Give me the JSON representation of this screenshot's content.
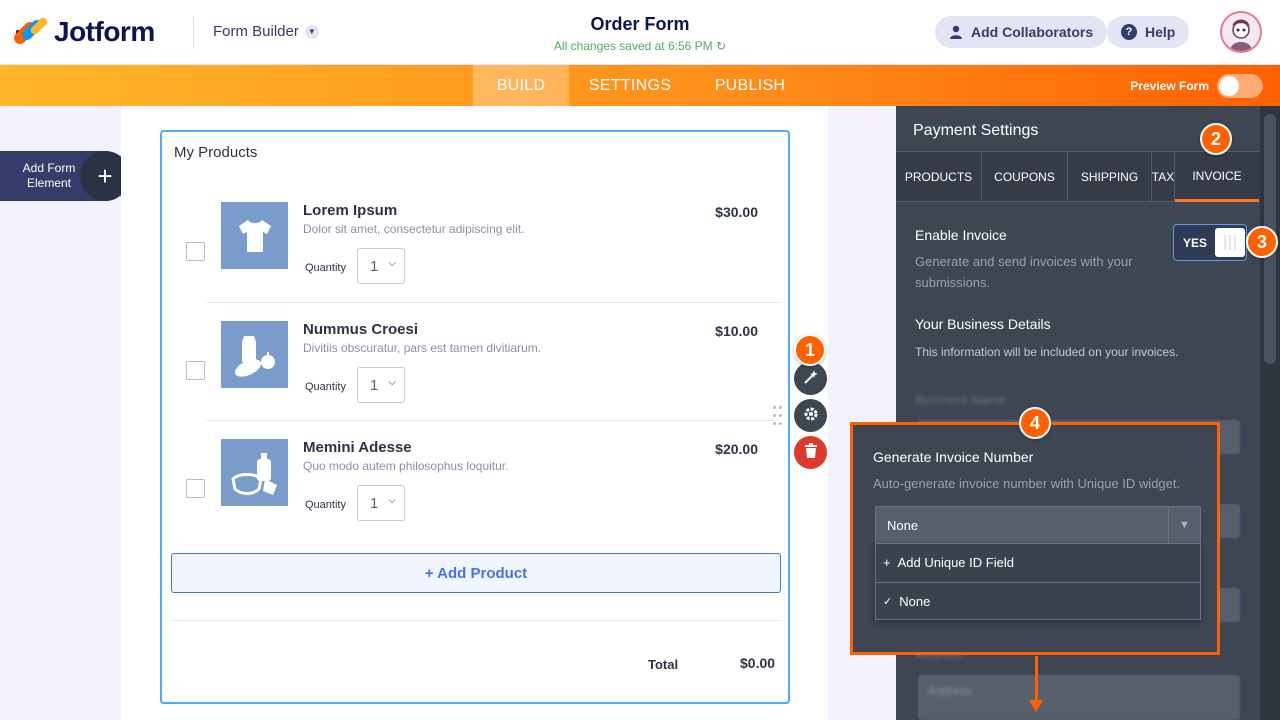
{
  "header": {
    "logo_text": "Jotform",
    "builder_label": "Form Builder",
    "form_title": "Order Form",
    "save_status": "All changes saved at 6:56 PM",
    "collaborators_label": "Add Collaborators",
    "help_label": "Help"
  },
  "nav": {
    "tabs": [
      {
        "label": "BUILD",
        "active": true
      },
      {
        "label": "SETTINGS",
        "active": false
      },
      {
        "label": "PUBLISH",
        "active": false
      }
    ],
    "preview_label": "Preview Form"
  },
  "left": {
    "add_element_label": "Add Form Element"
  },
  "form": {
    "field_title": "My Products",
    "quantity_label": "Quantity",
    "products": [
      {
        "name": "Lorem Ipsum",
        "description": "Dolor sit amet, consectetur adipiscing elit.",
        "quantity": "1",
        "price": "$30.00",
        "icon": "tshirt-icon"
      },
      {
        "name": "Nummus Croesi",
        "description": "Divitiis obscuratur, pars est tamen divitiarum.",
        "quantity": "1",
        "price": "$10.00",
        "icon": "groceries-icon"
      },
      {
        "name": "Memini Adesse",
        "description": "Quo modo autem philosophus loquitur.",
        "quantity": "1",
        "price": "$20.00",
        "icon": "hygiene-icon"
      }
    ],
    "add_product_label": "+ Add Product",
    "total_label": "Total",
    "total_value": "$0.00"
  },
  "badges": [
    "1",
    "2",
    "3",
    "4"
  ],
  "panel": {
    "title": "Payment Settings",
    "tabs": [
      "PRODUCTS",
      "COUPONS",
      "SHIPPING",
      "TAX",
      "INVOICE"
    ],
    "active_tab": "INVOICE",
    "enable_invoice_title": "Enable Invoice",
    "enable_invoice_desc": "Generate and send invoices with your submissions.",
    "toggle_label": "YES",
    "business_title": "Your Business Details",
    "business_desc": "This information will be included on your invoices.",
    "business_name_label": "Business Name",
    "address_label": "Address",
    "address_placeholder": "Address"
  },
  "popover": {
    "title": "Generate Invoice Number",
    "desc": "Auto-generate invoice number with Unique ID widget.",
    "selected": "None",
    "options": [
      {
        "prefix": "+",
        "label": "Add Unique ID Field"
      },
      {
        "prefix": "✓",
        "label": "None"
      }
    ]
  },
  "colors": {
    "accent_orange": "#ff6100",
    "brand_navy": "#0a1551",
    "link_blue": "#4573e3",
    "panel_bg": "#3e4652",
    "save_green": "#4cad5c"
  }
}
